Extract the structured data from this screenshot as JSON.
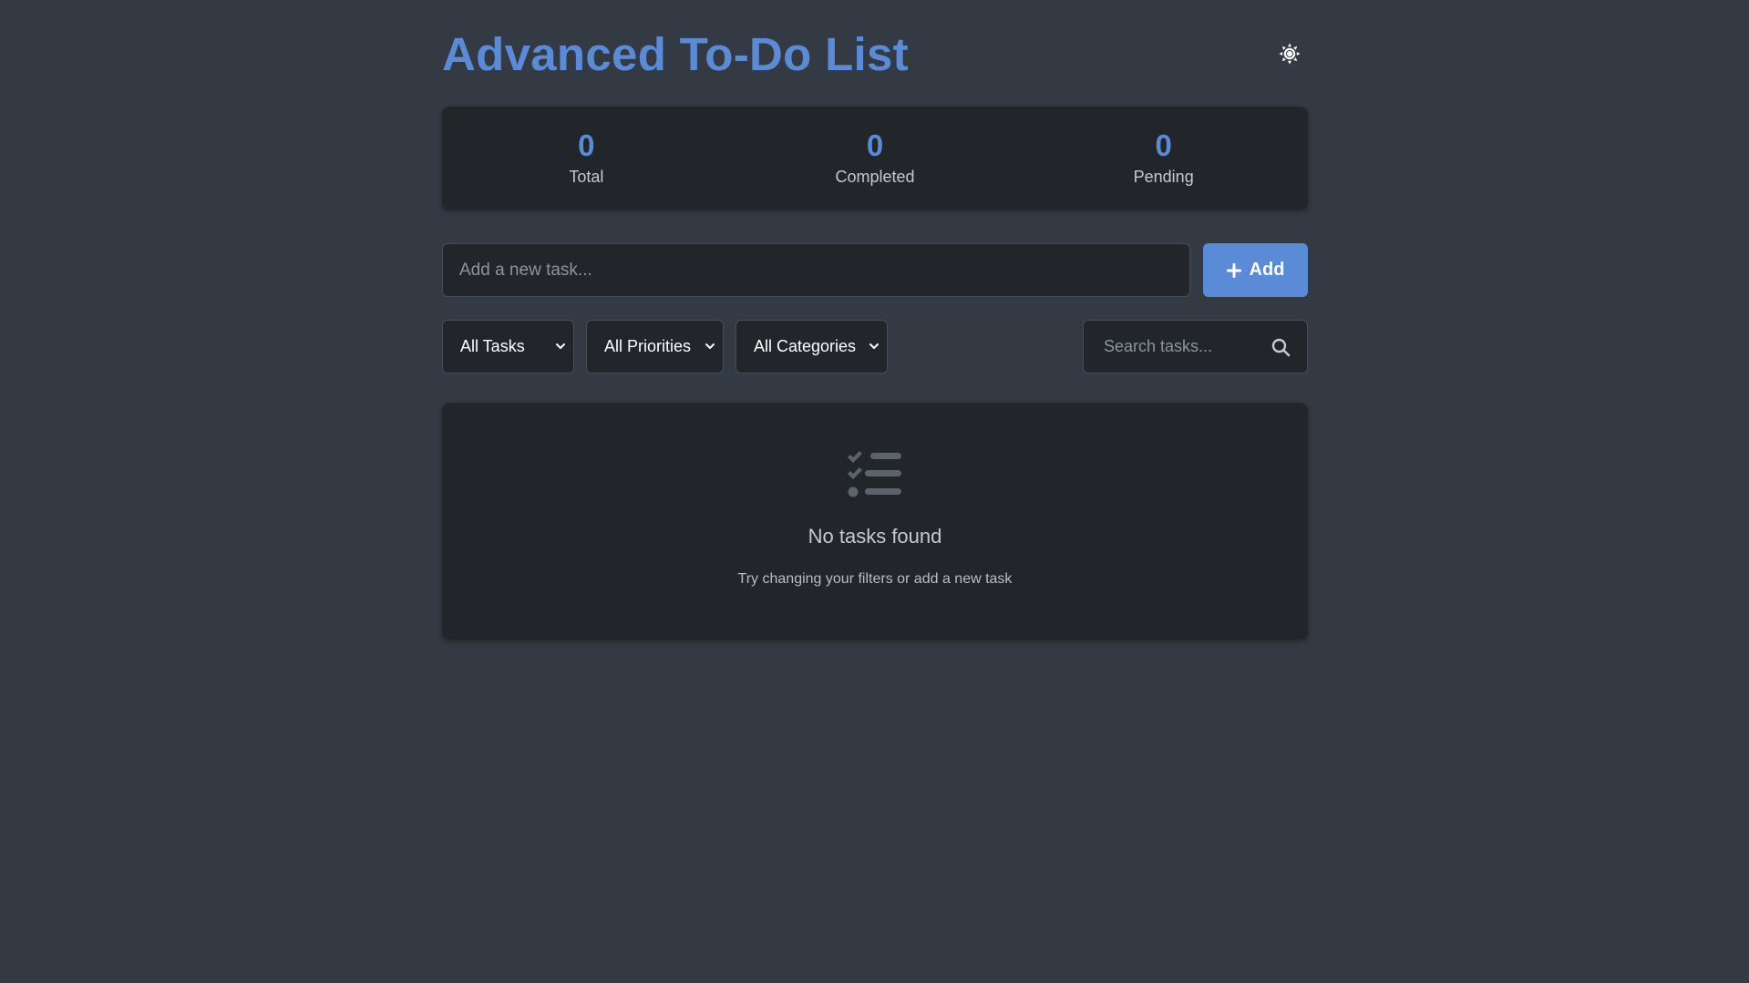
{
  "header": {
    "title": "Advanced To-Do List",
    "theme_icon": "sun-icon"
  },
  "stats": [
    {
      "value": "0",
      "label": "Total"
    },
    {
      "value": "0",
      "label": "Completed"
    },
    {
      "value": "0",
      "label": "Pending"
    }
  ],
  "add_task": {
    "placeholder": "Add a new task...",
    "button_label": "Add",
    "button_icon": "plus-icon"
  },
  "filters": {
    "status_selected": "All Tasks",
    "priority_selected": "All Priorities",
    "category_selected": "All Categories"
  },
  "search": {
    "placeholder": "Search tasks...",
    "icon": "search-icon"
  },
  "empty_state": {
    "icon": "tasks-list-icon",
    "title": "No tasks found",
    "subtitle": "Try changing your filters or add a new task"
  },
  "colors": {
    "background": "#343a43",
    "card": "#22252a",
    "accent": "#5b8ad6"
  }
}
